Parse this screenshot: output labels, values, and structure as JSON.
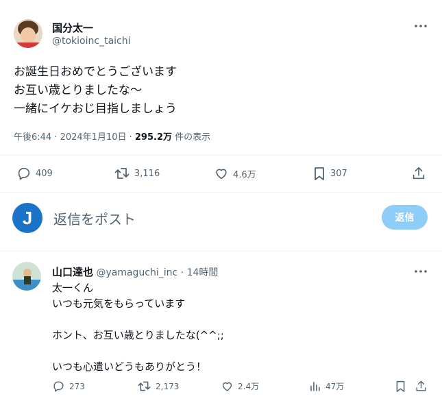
{
  "main_tweet": {
    "display_name": "国分太一",
    "handle": "@tokioinc_taichi",
    "lines": [
      "お誕生日おめでとうございます",
      "お互い歳とりましたな〜",
      "一緒にイケおじ目指しましょう"
    ],
    "time": "午後6:44 · 2024年1月10日 · ",
    "views": "295.2万",
    "views_suffix": " 件の表示",
    "stats": {
      "replies": "409",
      "retweets": "3,116",
      "likes": "4.6万",
      "bookmarks": "307"
    }
  },
  "composer": {
    "avatar_letter": "J",
    "placeholder": "返信をポスト",
    "reply_button": "返信"
  },
  "reply_tweet": {
    "display_name": "山口達也",
    "handle_time": "@yamaguchi_inc · 14時間",
    "lines": [
      "太一くん",
      "いつも元気をもらっています",
      "",
      "ホント、お互い歳とりましたな(^^;;",
      "",
      "いつも心遣いどうもありがとう！"
    ],
    "stats": {
      "replies": "273",
      "retweets": "2,173",
      "likes": "2.4万",
      "views": "47万"
    }
  },
  "colors": {
    "accent": "#1d9bf0",
    "text": "#0f1419",
    "muted": "#536471",
    "reply_button_bg": "#8ecdf8",
    "avatar_j": "#1c74c9"
  }
}
